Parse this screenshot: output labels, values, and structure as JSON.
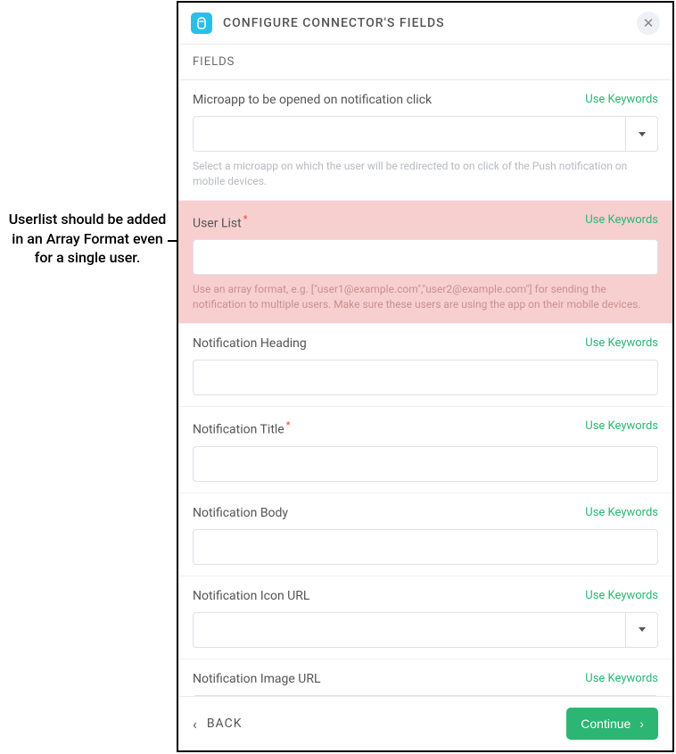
{
  "annotation": "Userlist should be added in an  Array Format even for a single user.",
  "header": {
    "title": "CONFIGURE CONNECTOR'S FIELDS"
  },
  "subheader": "FIELDS",
  "use_keywords_label": "Use Keywords",
  "fields": {
    "microapp": {
      "label": "Microapp to be opened on notification click",
      "value": "",
      "help": "Select a microapp on which the user will be redirected to on click of the Push notification on mobile devices."
    },
    "userlist": {
      "label": "User List",
      "value": "",
      "help": "Use an array format, e.g. [\"user1@example.com\",\"user2@example.com\"] for sending the notification to multiple users. Make sure these users are using the app on their mobile devices."
    },
    "heading": {
      "label": "Notification Heading",
      "value": ""
    },
    "title": {
      "label": "Notification Title",
      "value": ""
    },
    "body": {
      "label": "Notification Body",
      "value": ""
    },
    "icon_url": {
      "label": "Notification Icon URL",
      "value": ""
    },
    "image_url": {
      "label": "Notification Image URL",
      "value": ""
    }
  },
  "footer": {
    "back": "BACK",
    "continue": "Continue"
  }
}
